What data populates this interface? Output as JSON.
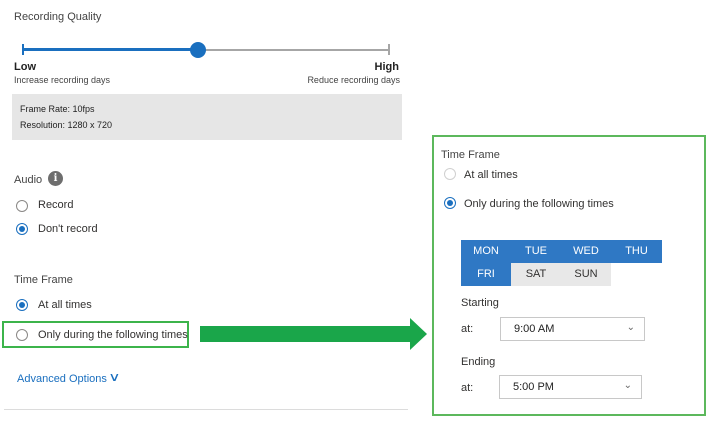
{
  "recording_quality": {
    "title": "Recording Quality",
    "slider_value_fraction": 0.5,
    "low_label": "Low",
    "low_sub": "Increase recording days",
    "high_label": "High",
    "high_sub": "Reduce recording days",
    "info": {
      "frame_rate": "Frame Rate: 10fps",
      "resolution": "Resolution: 1280 x 720"
    }
  },
  "audio": {
    "label": "Audio",
    "info_icon_glyph": "i",
    "options": [
      {
        "label": "Record",
        "selected": false
      },
      {
        "label": "Don't record",
        "selected": true
      }
    ]
  },
  "time_frame_left": {
    "label": "Time Frame",
    "options": [
      {
        "label": "At all times",
        "selected": true
      },
      {
        "label": "Only during the following times",
        "selected": false
      }
    ]
  },
  "advanced_options": {
    "label": "Advanced Options",
    "chevron": "∨"
  },
  "time_frame_right": {
    "label": "Time Frame",
    "options": [
      {
        "label": "At all times",
        "selected": false
      },
      {
        "label": "Only during the following times",
        "selected": true
      }
    ],
    "days": [
      {
        "label": "MON",
        "selected": true
      },
      {
        "label": "TUE",
        "selected": true
      },
      {
        "label": "WED",
        "selected": true
      },
      {
        "label": "THU",
        "selected": true
      },
      {
        "label": "FRI",
        "selected": true
      },
      {
        "label": "SAT",
        "selected": false
      },
      {
        "label": "SUN",
        "selected": false
      }
    ],
    "starting": {
      "label": "Starting",
      "at_label": "at:",
      "value": "9:00 AM"
    },
    "ending": {
      "label": "Ending",
      "at_label": "at:",
      "value": "5:00 PM"
    },
    "select_chevron": "⌄"
  },
  "colors": {
    "accent": "#1a6fbf",
    "day_selected": "#2f78c4",
    "highlight_green": "#3cb44b",
    "arrow_green": "#1aa64a"
  }
}
